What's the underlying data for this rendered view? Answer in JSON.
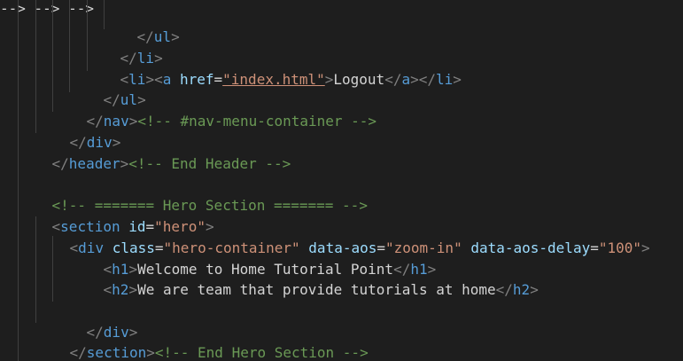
{
  "editor": {
    "top_fragment": {
      "part1": "",
      "part2": "",
      "part3": ""
    },
    "lines": [
      {
        "indent": "        ",
        "open": "</",
        "name": "ul",
        "close": ">"
      },
      {
        "indent": "      ",
        "open": "</",
        "name": "li",
        "close": ">"
      },
      {
        "indent": "      ",
        "li_open": "li",
        "a_tag": "a",
        "href_attr": "href",
        "href_value": "\"index.html\"",
        "text": "Logout",
        "a_close": "a",
        "li_close": "li"
      },
      {
        "indent": "    ",
        "open": "</",
        "name": "ul",
        "close": ">"
      },
      {
        "indent": "  ",
        "open": "</",
        "name": "nav",
        "close": ">",
        "comment": "<!-- #nav-menu-container -->"
      },
      {
        "indent": "  ",
        "open": "</",
        "name": "div",
        "close": ">"
      },
      {
        "indent": "",
        "open": "</",
        "name": "header",
        "close": ">",
        "comment": "<!-- End Header -->"
      },
      {
        "indent": ""
      },
      {
        "indent": "",
        "comment": "<!-- ======= Hero Section ======= -->"
      },
      {
        "indent": "",
        "name": "section",
        "attr": "id",
        "value": "\"hero\""
      },
      {
        "indent": "  ",
        "name": "div",
        "attr1": "class",
        "value1": "\"hero-container\"",
        "attr2": "data-aos",
        "value2": "\"zoom-in\"",
        "attr3": "data-aos-delay",
        "value3": "\"100\""
      },
      {
        "indent": "    ",
        "name": "h1",
        "text": "Welcome to Home Tutorial Point"
      },
      {
        "indent": "    ",
        "name": "h2",
        "text": "We are team that provide tutorials at home"
      },
      {
        "indent": ""
      },
      {
        "indent": "  ",
        "open": "</",
        "name": "div",
        "close": ">"
      },
      {
        "indent": "",
        "open": "</",
        "name": "section",
        "close": ">",
        "comment": "<!-- End Hero Section -->"
      }
    ]
  }
}
